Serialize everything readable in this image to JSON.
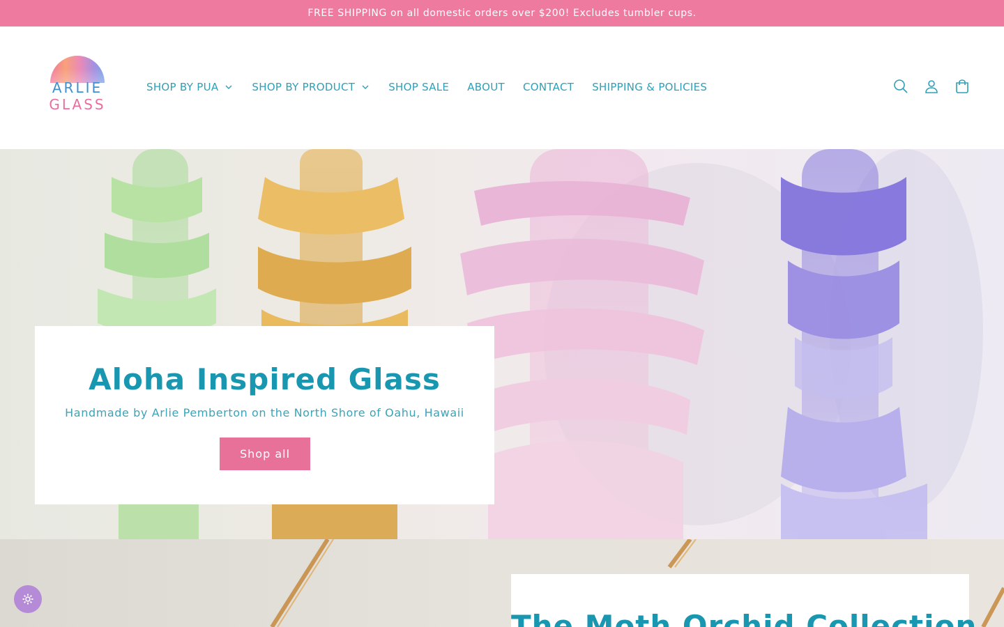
{
  "announcement": "FREE SHIPPING on all domestic orders over $200! Excludes tumbler cups.",
  "logo": {
    "line1": "ARLIE",
    "line2": "GLASS"
  },
  "nav": [
    {
      "label": "SHOP BY PUA",
      "dropdown": true
    },
    {
      "label": "SHOP BY PRODUCT",
      "dropdown": true
    },
    {
      "label": "SHOP SALE",
      "dropdown": false
    },
    {
      "label": "ABOUT",
      "dropdown": false
    },
    {
      "label": "CONTACT",
      "dropdown": false
    },
    {
      "label": "SHIPPING & POLICIES",
      "dropdown": false
    }
  ],
  "header_icons": [
    "search-icon",
    "account-icon",
    "cart-icon"
  ],
  "hero": {
    "title": "Aloha Inspired Glass",
    "subtitle": "Handmade by Arlie Pemberton on the North Shore of Oahu, Hawaii",
    "button": "Shop all"
  },
  "section2": {
    "title": "The Moth Orchid Collection"
  },
  "colors": {
    "announcement_bg": "#ef7aa0",
    "accent_teal": "#1996b0",
    "nav_text": "#2f9fb7",
    "button_pink": "#e8719a",
    "a11y_purple": "#b58ad6"
  }
}
